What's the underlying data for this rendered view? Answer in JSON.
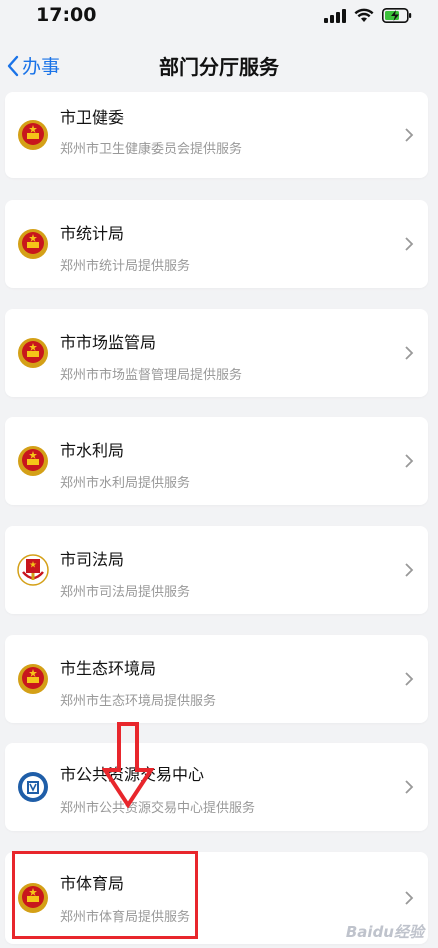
{
  "status": {
    "time": "17:00"
  },
  "nav": {
    "back_label": "办事",
    "title": "部门分厅服务"
  },
  "items": [
    {
      "name": "市卫健委",
      "desc": "郑州市卫生健康委员会提供服务",
      "icon": "national-emblem-icon"
    },
    {
      "name": "市统计局",
      "desc": "郑州市统计局提供服务",
      "icon": "national-emblem-icon"
    },
    {
      "name": "市市场监管局",
      "desc": "郑州市市场监督管理局提供服务",
      "icon": "national-emblem-icon"
    },
    {
      "name": "市水利局",
      "desc": "郑州市水利局提供服务",
      "icon": "national-emblem-icon"
    },
    {
      "name": "市司法局",
      "desc": "郑州市司法局提供服务",
      "icon": "justice-emblem-icon"
    },
    {
      "name": "市生态环境局",
      "desc": "郑州市生态环境局提供服务",
      "icon": "national-emblem-icon"
    },
    {
      "name": "市公共资源交易中心",
      "desc": "郑州市公共资源交易中心提供服务",
      "icon": "resource-center-logo-icon"
    },
    {
      "name": "市体育局",
      "desc": "郑州市体育局提供服务",
      "icon": "national-emblem-icon"
    }
  ],
  "watermark": "Baidu经验",
  "colors": {
    "accent": "#1a73e8",
    "annotation": "#e8262c"
  }
}
